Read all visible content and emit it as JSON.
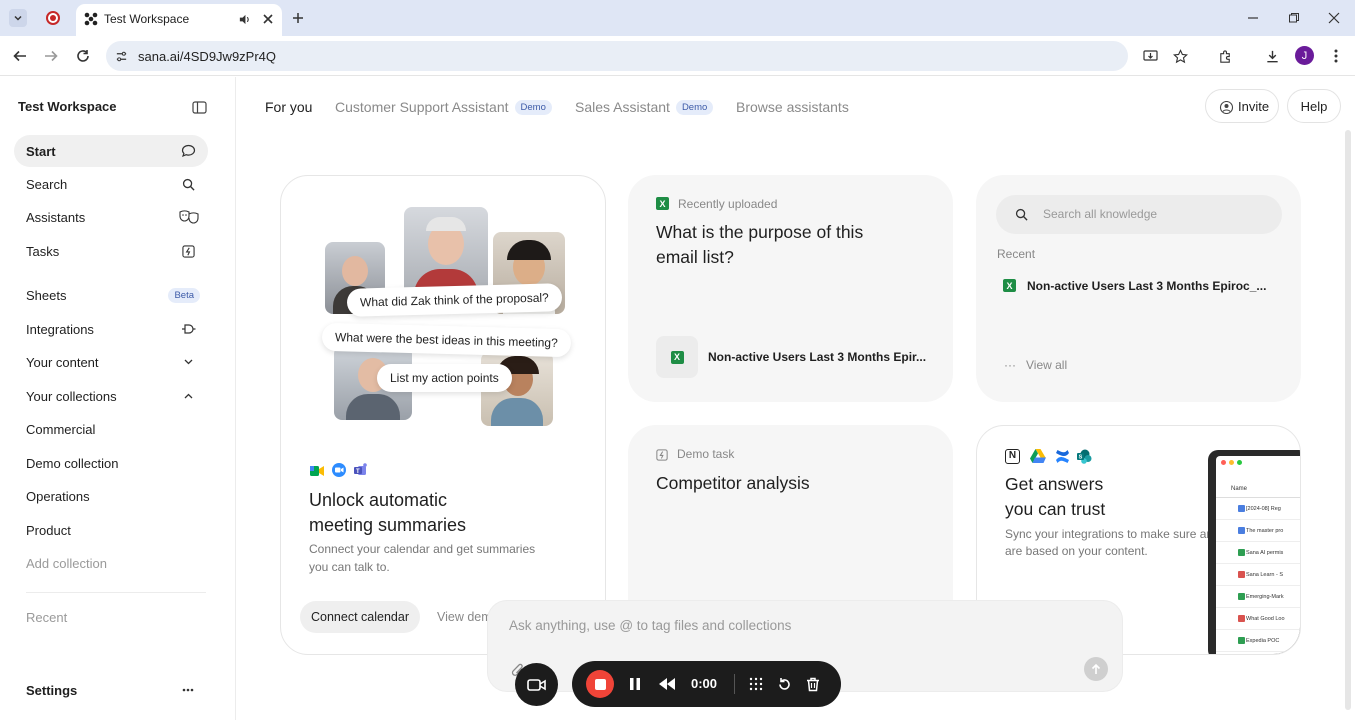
{
  "browser": {
    "tab_title": "Test Workspace",
    "url": "sana.ai/4SD9Jw9zPr4Q",
    "profile_initial": "J"
  },
  "sidebar": {
    "workspace_name": "Test Workspace",
    "items": [
      {
        "label": "Start"
      },
      {
        "label": "Search"
      },
      {
        "label": "Assistants"
      },
      {
        "label": "Tasks"
      },
      {
        "label": "Sheets",
        "badge": "Beta"
      },
      {
        "label": "Integrations"
      },
      {
        "label": "Your content"
      },
      {
        "label": "Your collections"
      }
    ],
    "collections": [
      "Commercial",
      "Demo collection",
      "Operations",
      "Product"
    ],
    "add_collection": "Add collection",
    "recent": "Recent",
    "settings": "Settings"
  },
  "topnav": {
    "tabs": [
      {
        "label": "For you"
      },
      {
        "label": "Customer Support Assistant",
        "badge": "Demo"
      },
      {
        "label": "Sales Assistant",
        "badge": "Demo"
      },
      {
        "label": "Browse assistants"
      }
    ],
    "invite": "Invite",
    "help": "Help"
  },
  "meeting_card": {
    "bubbles": [
      "What did Zak think of the proposal?",
      "What were the best ideas in this meeting?",
      "List my action points"
    ],
    "title_line1": "Unlock automatic",
    "title_line2": "meeting summaries",
    "desc_line1": "Connect your calendar and get summaries",
    "desc_line2": "you can talk to.",
    "connect_button": "Connect calendar",
    "view_demo": "View dem"
  },
  "upload_card": {
    "label": "Recently uploaded",
    "title_line1": "What is the purpose of this",
    "title_line2": "email list?",
    "file_name": "Non-active Users Last 3 Months Epir..."
  },
  "knowledge_card": {
    "search_placeholder": "Search all knowledge",
    "recent_label": "Recent",
    "file_name": "Non-active Users Last 3 Months Epiroc_...",
    "view_all": "View all"
  },
  "task_card": {
    "label": "Demo task",
    "title": "Competitor analysis"
  },
  "trust_card": {
    "title_line1": "Get answers",
    "title_line2": "you can trust",
    "desc_line1": "Sync your integrations to make sure answers",
    "desc_line2": "are based on your content.",
    "mini_header": "Name",
    "mini_rows": [
      {
        "text": "[2024-08] Reg",
        "color": "#4a7ee0"
      },
      {
        "text": "The master pro",
        "color": "#4a7ee0"
      },
      {
        "text": "Sana AI permis",
        "color": "#2e9e52"
      },
      {
        "text": "Sana Learn - S",
        "color": "#d9534f"
      },
      {
        "text": "Emerging-Mark",
        "color": "#2e9e52"
      },
      {
        "text": "What Good Loo",
        "color": "#d9534f"
      },
      {
        "text": "Expedia POC",
        "color": "#2e9e52"
      }
    ]
  },
  "composer": {
    "placeholder": "Ask anything, use @ to tag files and collections"
  },
  "recorder": {
    "time": "0:00"
  },
  "colors": {
    "accent_badge_bg": "#e5ecfa",
    "excel_green": "#1e8d45",
    "record_red": "#f04438",
    "profile_purple": "#6a1b9a"
  }
}
